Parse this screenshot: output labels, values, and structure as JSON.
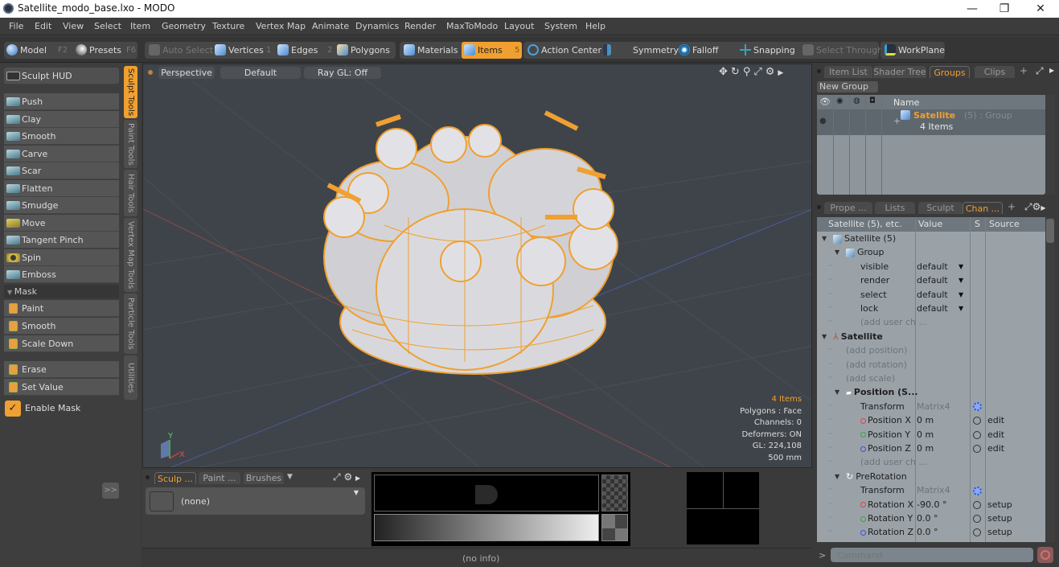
{
  "window": {
    "title": "Satellite_modo_base.lxo - MODO",
    "controls": {
      "minimize": "—",
      "restore": "❐",
      "close": "✕"
    }
  },
  "menubar": [
    "File",
    "Edit",
    "View",
    "Select",
    "Item",
    "Geometry",
    "Texture",
    "Vertex Map",
    "Animate",
    "Dynamics",
    "Render",
    "MaxToModo",
    "Layout",
    "System",
    "Help"
  ],
  "toolbar": {
    "model": {
      "label": "Model",
      "key": "F2"
    },
    "presets": {
      "label": "Presets",
      "key": "F6"
    },
    "auto_select": "Auto Select",
    "vertices": {
      "label": "Vertices",
      "key": "1"
    },
    "edges": {
      "label": "Edges",
      "key": "2"
    },
    "polygons": "Polygons",
    "materials": "Materials",
    "items": {
      "label": "Items",
      "key": "5"
    },
    "action_center": "Action Center",
    "symmetry": "Symmetry",
    "falloff": "Falloff",
    "snapping": "Snapping",
    "select_through": "Select Through",
    "workplane": "WorkPlane",
    "accent_color": "#f0a030"
  },
  "left_panel": {
    "sculpt_hud": "Sculpt HUD",
    "tools": [
      "Push",
      "Clay",
      "Smooth",
      "Carve",
      "Scar",
      "Flatten",
      "Smudge",
      "Move",
      "Tangent Pinch",
      "Spin",
      "Emboss"
    ],
    "mask_header": "Mask",
    "mask_tools": [
      "Paint",
      "Smooth",
      "Scale Down"
    ],
    "mask_tools2": [
      "Erase",
      "Set Value"
    ],
    "enable_mask": {
      "label": "Enable Mask",
      "checked": true
    },
    "expand_button": ">>",
    "vertical_tabs": [
      "Sculpt Tools",
      "Paint Tools",
      "Hair Tools",
      "Vertex Map Tools",
      "Particle Tools",
      "Utilities"
    ],
    "active_tab": "Sculpt Tools"
  },
  "viewport": {
    "view_mode": "Perspective",
    "shading": "Default",
    "raygl": "Ray GL: Off",
    "stats": {
      "items": "4 Items",
      "polygons": "Polygons : Face",
      "channels": "Channels: 0",
      "deformers": "Deformers: ON",
      "gl": "GL: 224,108",
      "scale": "500 mm"
    },
    "axis_labels": {
      "y": "Y",
      "x": "X"
    }
  },
  "bottom_panel": {
    "tabs": [
      "Sculp ...",
      "Paint ...",
      "Brushes"
    ],
    "active_tab": "Sculp ...",
    "preset_value": "(none)"
  },
  "status_bar": "(no info)",
  "groups_panel": {
    "tabs": [
      "Item List",
      "Shader Tree",
      "Groups",
      "Clips"
    ],
    "active_tab": "Groups",
    "new_group_button": "New Group",
    "column_name": "Name",
    "group": {
      "name": "Satellite",
      "suffix": "(5) : Group",
      "count": "4 Items"
    }
  },
  "channels_panel": {
    "tabs": [
      "Prope ...",
      "Lists",
      "Sculpt",
      "Chan ..."
    ],
    "active_tab": "Chan ...",
    "columns": [
      "Satellite (5), etc.",
      "Value",
      "S",
      "Source"
    ],
    "rows": [
      {
        "name": "Satellite (5)",
        "indent": 0,
        "type": "group-root",
        "value": "",
        "source": ""
      },
      {
        "name": "Group",
        "indent": 1,
        "type": "group",
        "value": "",
        "source": ""
      },
      {
        "name": "visible",
        "indent": 2,
        "value": "default",
        "dropdown": true,
        "source": ""
      },
      {
        "name": "render",
        "indent": 2,
        "value": "default",
        "dropdown": true,
        "source": ""
      },
      {
        "name": "select",
        "indent": 2,
        "value": "default",
        "dropdown": true,
        "source": ""
      },
      {
        "name": "lock",
        "indent": 2,
        "value": "default",
        "dropdown": true,
        "source": ""
      },
      {
        "name": "(add user ch ...",
        "indent": 2,
        "muted": true,
        "value": "",
        "source": ""
      },
      {
        "name": "Satellite",
        "indent": 0,
        "type": "locator",
        "bold": true,
        "value": "",
        "source": ""
      },
      {
        "name": "(add position)",
        "indent": 1,
        "muted": true,
        "value": "",
        "source": ""
      },
      {
        "name": "(add rotation)",
        "indent": 1,
        "muted": true,
        "value": "",
        "source": ""
      },
      {
        "name": "(add scale)",
        "indent": 1,
        "muted": true,
        "value": "",
        "source": ""
      },
      {
        "name": "Position (S...",
        "indent": 1,
        "type": "position",
        "bold": true,
        "value": "",
        "source": ""
      },
      {
        "name": "Transform",
        "indent": 2,
        "value": "Matrix4",
        "value_muted": true,
        "state": "gear",
        "source": ""
      },
      {
        "name": "Position X",
        "indent": 2,
        "dot": "#e04050",
        "value": "0 m",
        "state": "radio",
        "source": "edit"
      },
      {
        "name": "Position Y",
        "indent": 2,
        "dot": "#40a040",
        "value": "0 m",
        "state": "radio",
        "source": "edit"
      },
      {
        "name": "Position Z",
        "indent": 2,
        "dot": "#4050e0",
        "value": "0 m",
        "state": "radio",
        "source": "edit"
      },
      {
        "name": "(add user ch ...",
        "indent": 2,
        "muted": true,
        "value": "",
        "source": ""
      },
      {
        "name": "PreRotation",
        "indent": 1,
        "type": "rotation",
        "value": "",
        "source": ""
      },
      {
        "name": "Transform",
        "indent": 2,
        "value": "Matrix4",
        "value_muted": true,
        "state": "gear",
        "source": ""
      },
      {
        "name": "Rotation X",
        "indent": 2,
        "dot": "#e04050",
        "value": "-90.0 °",
        "state": "radio",
        "source": "setup"
      },
      {
        "name": "Rotation Y",
        "indent": 2,
        "dot": "#40a040",
        "value": "0.0 °",
        "state": "radio",
        "source": "setup"
      },
      {
        "name": "Rotation Z",
        "indent": 2,
        "dot": "#4050e0",
        "value": "0.0 °",
        "state": "radio",
        "source": "setup"
      }
    ]
  },
  "command_bar": {
    "prompt": ">",
    "placeholder": "Command"
  }
}
